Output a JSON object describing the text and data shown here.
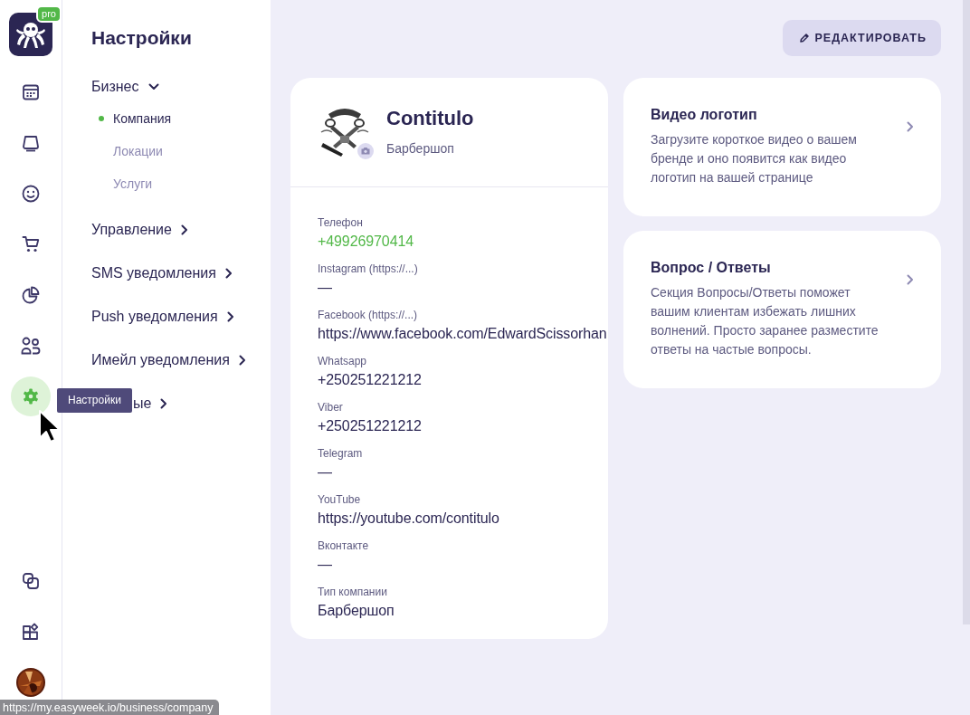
{
  "app": {
    "badge": "pro"
  },
  "rail": [
    {
      "kind": "calendar",
      "selected": false
    },
    {
      "kind": "display",
      "selected": false
    },
    {
      "kind": "smiley",
      "selected": false
    },
    {
      "kind": "cart",
      "selected": false
    },
    {
      "kind": "pie",
      "selected": false
    },
    {
      "kind": "people",
      "selected": false
    },
    {
      "kind": "gear",
      "selected": true
    }
  ],
  "rail_bottom": [
    {
      "kind": "copy",
      "selected": false
    },
    {
      "kind": "apps",
      "selected": false
    }
  ],
  "tooltip": "Настройки",
  "settings_menu": {
    "title": "Настройки",
    "sections": [
      {
        "label": "Бизнес",
        "expanded": true,
        "children": [
          {
            "label": "Компания",
            "selected": true
          },
          {
            "label": "Локации",
            "selected": false
          },
          {
            "label": "Услуги",
            "selected": false
          }
        ]
      },
      {
        "label": "Управление",
        "expanded": false
      },
      {
        "label": "SMS уведомления",
        "expanded": false
      },
      {
        "label": "Push уведомления",
        "expanded": false
      },
      {
        "label": "Имейл уведомления",
        "expanded": false
      },
      {
        "label": "ые",
        "expanded": false,
        "partly_hidden": true
      }
    ]
  },
  "edit_button": "РЕДАКТИРОВАТЬ",
  "company": {
    "name": "Contitulo",
    "type": "Барбершоп",
    "fields": [
      {
        "label": "Телефон",
        "value": "+49926970414",
        "kind": "phone"
      },
      {
        "label": "Instagram (https://...)",
        "value": "—",
        "kind": "text"
      },
      {
        "label": "Facebook (https://...)",
        "value": "https://www.facebook.com/EdwardScissorhan",
        "kind": "text"
      },
      {
        "label": "Whatsapp",
        "value": "+250251221212",
        "kind": "text"
      },
      {
        "label": "Viber",
        "value": "+250251221212",
        "kind": "text"
      },
      {
        "label": "Telegram",
        "value": "—",
        "kind": "text"
      },
      {
        "label": "YouTube",
        "value": "https://youtube.com/contitulo",
        "kind": "text"
      },
      {
        "label": "Вконтакте",
        "value": "—",
        "kind": "text"
      },
      {
        "label": "Тип компании",
        "value": "Барбершоп",
        "kind": "text"
      }
    ]
  },
  "feature_cards": [
    {
      "title": "Видео логотип",
      "text": "Загрузите короткое видео о вашем бренде и оно появится как видео логотип на вашей странице"
    },
    {
      "title": "Вопрос / Ответы",
      "text": "Секция Вопросы/Ответы поможет вашим клиентам избежать лишних волнений. Просто заранее разместите ответы на частые вопросы."
    }
  ],
  "status_url": "https://my.easyweek.io/business/company"
}
